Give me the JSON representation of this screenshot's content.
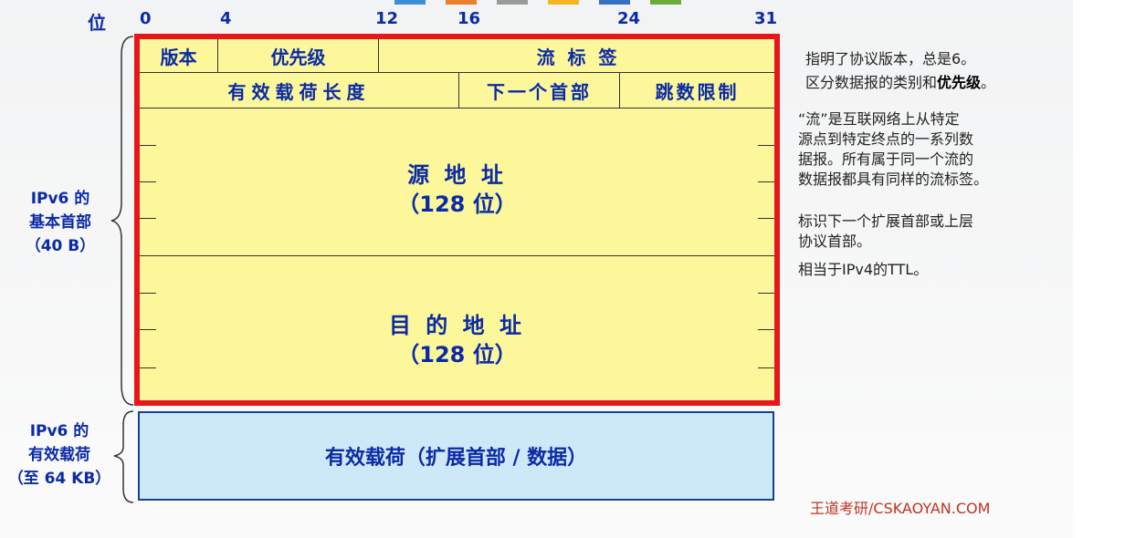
{
  "colors": {
    "field_text": "#0b2aa6",
    "header_fill": "#fbf79a",
    "header_border": "#e8161b",
    "payload_fill": "#cde9f8",
    "brand": "#c0321e",
    "top_swatches": [
      "#3d8ed6",
      "#e8822d",
      "#9a9a9a",
      "#f2b71f",
      "#3a6fc2",
      "#6aaa3f"
    ]
  },
  "bit_axis": {
    "label": "位",
    "marks": [
      "0",
      "4",
      "12",
      "16",
      "24",
      "31"
    ]
  },
  "header": {
    "row1": {
      "version": "版本",
      "priority": "优先级",
      "flow_label": "流  标  签"
    },
    "row2": {
      "payload_length": "有效载荷长度",
      "next_header": "下一个首部",
      "hop_limit": "跳数限制"
    },
    "source": {
      "name": "源 地 址",
      "size": "（128 位）"
    },
    "destination": {
      "name": "目 的 地 址",
      "size": "（128 位）"
    }
  },
  "payload_box": {
    "label": "有效载荷（扩展首部 / 数据）"
  },
  "side_labels": {
    "basic_header": [
      "IPv6 的",
      "基本首部",
      "（40 B）"
    ],
    "payload": [
      "IPv6 的",
      "有效载荷",
      "（至 64 KB）"
    ]
  },
  "notes": {
    "version": "指明了协议版本，总是6。",
    "priority_prefix": "区分数据报的类别和",
    "priority_bold": "优先级",
    "priority_suffix": "。",
    "flow": [
      "“流”是互联网络上从特定",
      "源点到特定终点的一系列数",
      "据报。所有属于同一个流的",
      "数据报都具有同样的流标签。"
    ],
    "next_header": [
      "标识下一个扩展首部或上层",
      "协议首部。"
    ],
    "hop_limit": "相当于IPv4的TTL。"
  },
  "brand": "王道考研/CSKAOYAN.COM"
}
